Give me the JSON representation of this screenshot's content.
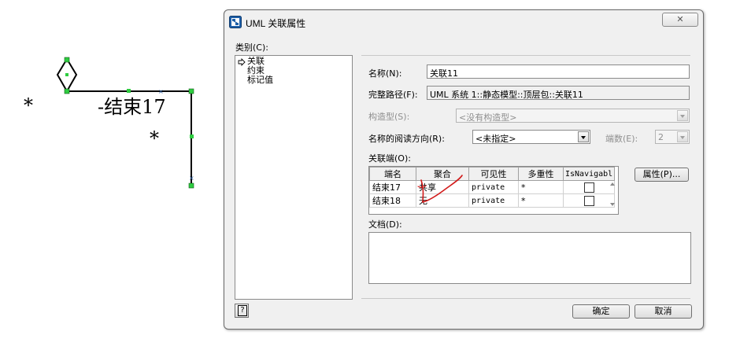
{
  "canvas": {
    "mult_left": "*",
    "role_label": "-结束17",
    "mult_right": "*"
  },
  "dialog": {
    "title": "UML 关联属性",
    "close_symbol": "✕",
    "category_label": "类别(C):",
    "categories": [
      {
        "label": "关联",
        "selected": true
      },
      {
        "label": "约束"
      },
      {
        "label": "标记值"
      }
    ],
    "fields": {
      "name_label": "名称(N):",
      "name_value": "关联11",
      "fullpath_label": "完整路径(F):",
      "fullpath_value": "UML 系统 1::静态模型::顶层包::关联11",
      "stereotype_label": "构造型(S):",
      "stereotype_value": "<没有构造型>",
      "read_dir_label": "名称的阅读方向(R):",
      "read_dir_value": "<未指定>",
      "ends_count_label": "端数(E):",
      "ends_count_value": "2"
    },
    "ends": {
      "label": "关联端(O):",
      "columns": [
        "端名",
        "聚合",
        "可见性",
        "多重性",
        "IsNavigabl"
      ],
      "rows": [
        {
          "name": "结束17",
          "aggregation": "共享",
          "visibility": "private",
          "multiplicity": "*",
          "navigable": false
        },
        {
          "name": "结束18",
          "aggregation": "无",
          "visibility": "private",
          "multiplicity": "*",
          "navigable": false
        }
      ],
      "properties_button": "属性(P)..."
    },
    "doc_label": "文档(D):",
    "doc_value": "",
    "ok_button": "确定",
    "cancel_button": "取消",
    "help_symbol": "?"
  },
  "colors": {
    "connector": "#000000",
    "handle_green": "#2ecc40",
    "annotation_red": "#d21a1a",
    "dialog_bg": "#f0f0f0"
  }
}
